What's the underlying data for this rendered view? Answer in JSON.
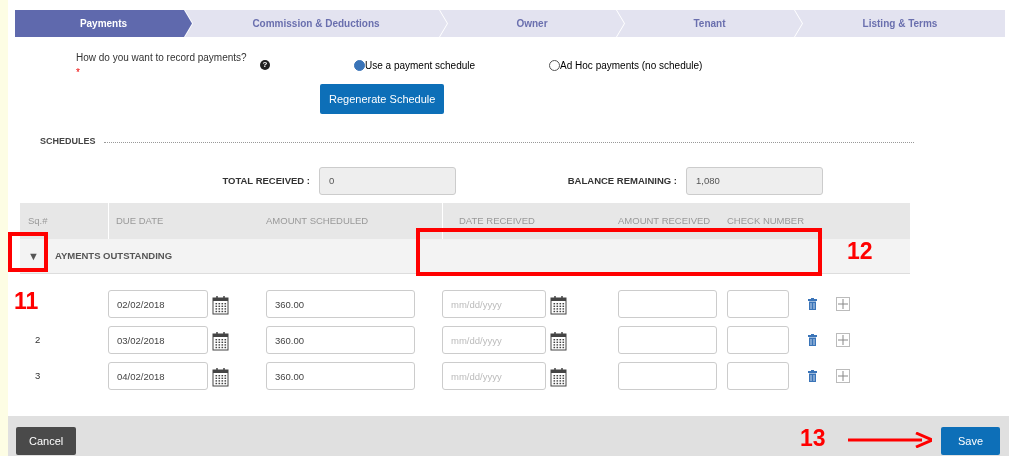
{
  "tabs": [
    {
      "label": "Payments",
      "selected": true
    },
    {
      "label": "Commission & Deductions",
      "selected": false
    },
    {
      "label": "Owner",
      "selected": false
    },
    {
      "label": "Tenant",
      "selected": false
    },
    {
      "label": "Listing & Terms",
      "selected": false
    }
  ],
  "question": {
    "label": "How do you want to record payments?",
    "required_mark": "*",
    "help": "?"
  },
  "options": [
    {
      "label": "Use a payment schedule",
      "selected": true
    },
    {
      "label": "Ad Hoc payments (no schedule)",
      "selected": false
    }
  ],
  "regenerate_button": "Regenerate Schedule",
  "section_title": "SCHEDULES",
  "totals": [
    {
      "label": "TOTAL RECEIVED :",
      "value": "0"
    },
    {
      "label": "BALANCE REMAINING :",
      "value": "1,080"
    }
  ],
  "table": {
    "columns": [
      "Sq.#",
      "DUE DATE",
      "AMOUNT SCHEDULED",
      "DATE RECEIVED",
      "AMOUNT RECEIVED",
      "CHECK NUMBER"
    ],
    "group": {
      "toggle": "▼",
      "label": "AYMENTS OUTSTANDING",
      "expanded": true
    },
    "rows": [
      {
        "due_date": "02/02/2018",
        "amount_scheduled": "360.00",
        "date_received_placeholder": "mm/dd/yyyy"
      },
      {
        "seq": "2",
        "due_date": "03/02/2018",
        "amount_scheduled": "360.00",
        "date_received_placeholder": "mm/dd/yyyy"
      },
      {
        "seq": "3",
        "due_date": "04/02/2018",
        "amount_scheduled": "360.00",
        "date_received_placeholder": "mm/dd/yyyy"
      }
    ]
  },
  "footer": {
    "cancel": "Cancel",
    "save": "Save"
  },
  "annotations": [
    {
      "kind": "box"
    },
    {
      "kind": "box"
    },
    {
      "kind": "label",
      "text": "11"
    },
    {
      "kind": "label",
      "text": "12"
    },
    {
      "kind": "label",
      "text": "13"
    },
    {
      "kind": "arrow"
    }
  ]
}
